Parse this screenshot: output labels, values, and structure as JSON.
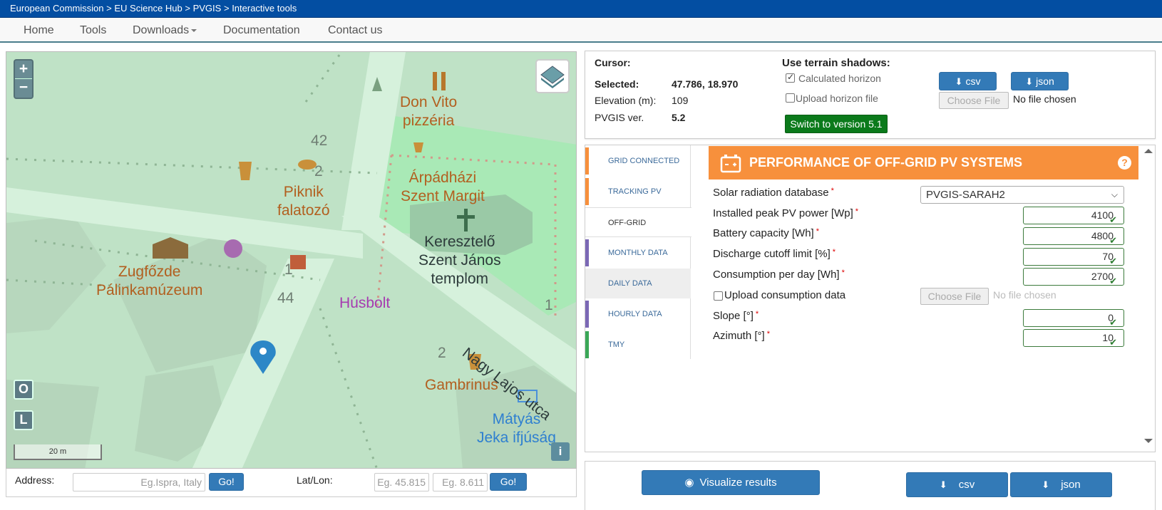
{
  "breadcrumb": {
    "items": [
      "European Commission",
      "EU Science Hub",
      "PVGIS",
      "Interactive tools"
    ],
    "separator": ">"
  },
  "nav": {
    "home": "Home",
    "tools": "Tools",
    "downloads": "Downloads",
    "documentation": "Documentation",
    "contact": "Contact us"
  },
  "map": {
    "zoom_in": "+",
    "zoom_out": "−",
    "btn_o": "O",
    "btn_l": "L",
    "info": "i",
    "scale": "20 m",
    "labels": {
      "don_vito": "Don Vito\npizzéria",
      "arpadhazi": "Árpádházi\nSzent Margit",
      "keresztelo": "Keresztelő\nSzent János\ntemplom",
      "piknik": "Piknik\nfalatozó",
      "zugfozde": "Zugfőzde\nPálinkamúzeum",
      "husbolt": "Húsbolt",
      "nagy_lajos": "Nagy Lajos utca",
      "gambrinus": "Gambrinus",
      "matyas": "Mátyás\nJeka ifjúság",
      "num_42": "42",
      "num_2a": "2",
      "num_1a": "1",
      "num_44": "44",
      "num_1b": "1",
      "num_2b": "2"
    }
  },
  "address_bar": {
    "address_label": "Address:",
    "address_placeholder": "Eg.Ispra, Italy",
    "go": "Go!",
    "latlon_label": "Lat/Lon:",
    "lat_placeholder": "Eg. 45.815",
    "lon_placeholder": "Eg. 8.611"
  },
  "info": {
    "cursor_label": "Cursor:",
    "selected_label": "Selected:",
    "selected_value": "47.786, 18.970",
    "elevation_label": "Elevation (m):",
    "elevation_value": "109",
    "version_label": "PVGIS ver.",
    "version_value": "5.2",
    "terrain_title": "Use terrain shadows:",
    "calc_horizon": "Calculated horizon",
    "calc_horizon_checked": true,
    "upload_horizon": "Upload horizon file",
    "upload_horizon_checked": false,
    "switch_version": "Switch to version 5.1",
    "csv": "csv",
    "json": "json",
    "choose_file": "Choose File",
    "no_file": "No file chosen"
  },
  "tabs": [
    {
      "label": "GRID CONNECTED",
      "color": "#f7903c"
    },
    {
      "label": "TRACKING PV",
      "color": "#f7903c"
    },
    {
      "label": "OFF-GRID",
      "color": "#f7903c",
      "active": true
    },
    {
      "label": "MONTHLY DATA",
      "color": "#7b68b5"
    },
    {
      "label": "DAILY DATA",
      "color": "#7b68b5"
    },
    {
      "label": "HOURLY DATA",
      "color": "#7b68b5"
    },
    {
      "label": "TMY",
      "color": "#3aa757"
    }
  ],
  "form": {
    "title": "PERFORMANCE OF OFF-GRID PV SYSTEMS",
    "required_mark": "*",
    "db_label": "Solar radiation database",
    "db_value": "PVGIS-SARAH2",
    "peak_label": "Installed peak PV power [Wp]",
    "peak_value": "4100",
    "battery_label": "Battery capacity [Wh]",
    "battery_value": "4800",
    "cutoff_label": "Discharge cutoff limit [%]",
    "cutoff_value": "70",
    "consumption_label": "Consumption per day [Wh]",
    "consumption_value": "2700",
    "upload_consumption": "Upload consumption data",
    "upload_consumption_checked": false,
    "slope_label": "Slope [°]",
    "slope_value": "0",
    "azimuth_label": "Azimuth [°]",
    "azimuth_value": "10",
    "choose_file": "Choose File",
    "no_file": "No file chosen"
  },
  "bottom": {
    "visualize": "Visualize results",
    "csv": "csv",
    "json": "json"
  },
  "colors": {
    "topbar": "#034ea2",
    "header_orange": "#f7903c",
    "button_blue": "#337ab7",
    "switch_green": "#0b7a1b"
  }
}
